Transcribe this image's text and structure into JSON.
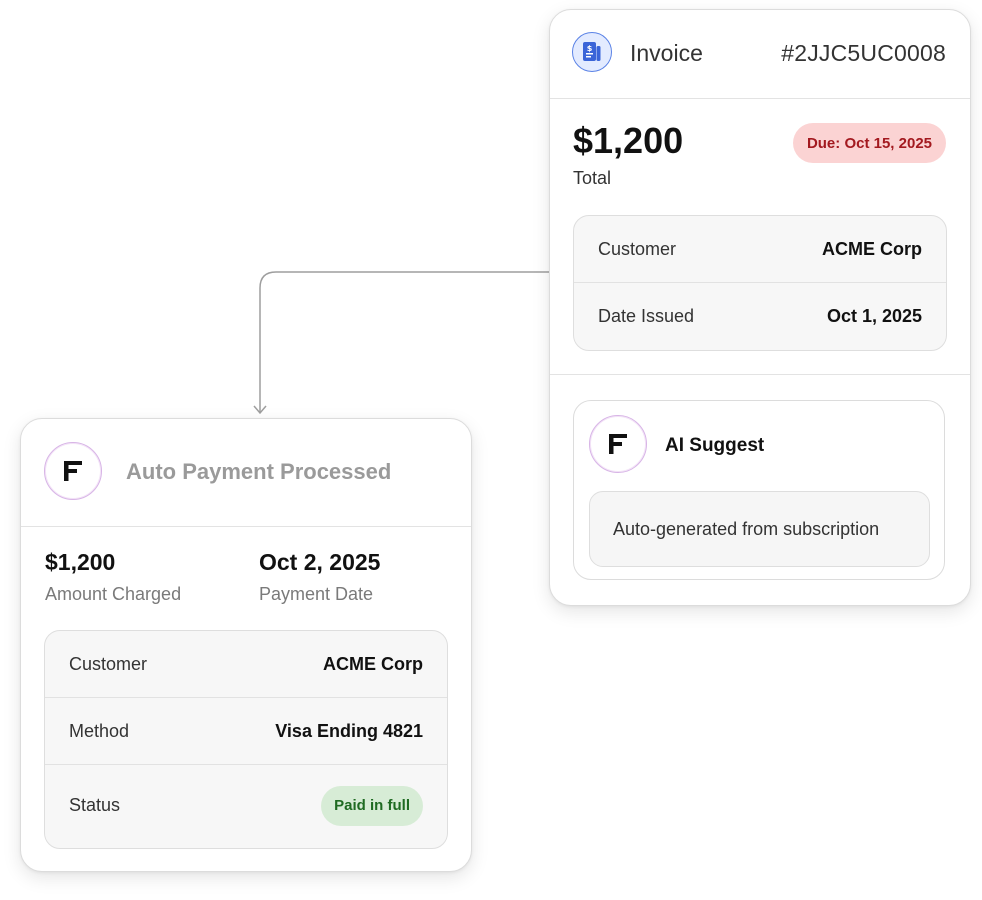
{
  "invoice": {
    "title": "Invoice",
    "number": "#2JJC5UC0008",
    "amount": "$1,200",
    "amount_label": "Total",
    "due_badge": "Due: Oct 15, 2025",
    "details": [
      {
        "label": "Customer",
        "value": "ACME Corp"
      },
      {
        "label": "Date Issued",
        "value": "Oct 1, 2025"
      }
    ],
    "ai": {
      "title": "AI Suggest",
      "text": "Auto-generated from subscription"
    }
  },
  "payment": {
    "title": "Auto Payment Processed",
    "amount": "$1,200",
    "amount_label": "Amount Charged",
    "date": "Oct 2, 2025",
    "date_label": "Payment Date",
    "details": [
      {
        "label": "Customer",
        "value": "ACME Corp"
      },
      {
        "label": "Method",
        "value": "Visa Ending 4821"
      }
    ],
    "status_label": "Status",
    "status_badge": "Paid in full"
  },
  "colors": {
    "due_badge_bg": "#fbd3d3",
    "due_badge_text": "#a3191f",
    "paid_badge_bg": "#d7ecd6",
    "paid_badge_text": "#1f6b22",
    "invoice_icon": "#3a64d8"
  },
  "icons": {
    "invoice_icon": "invoice-document-icon",
    "brand_logo": "brand-f-logo-icon"
  }
}
